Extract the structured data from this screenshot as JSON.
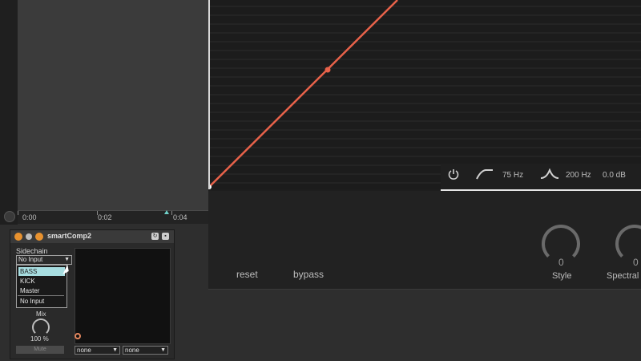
{
  "timeline": {
    "labels": [
      "0:00",
      "0:02",
      "0:04"
    ]
  },
  "plugin": {
    "eq": {
      "low_freq": "75 Hz",
      "mid_freq": "200 Hz",
      "gain": "0.0 dB"
    },
    "buttons": {
      "reset": "reset",
      "bypass": "bypass"
    },
    "knobs": [
      {
        "value": "0",
        "label": "Style"
      },
      {
        "value": "0",
        "label": "Spectral"
      }
    ],
    "curve_color": "#e8624a"
  },
  "device": {
    "title": "smartComp2",
    "sidechain_label": "Sidechain",
    "sidechain_value": "No Input",
    "dropdown_options": [
      "BASS",
      "KICK",
      "Master",
      "No Input"
    ],
    "selected_option": "BASS",
    "mix_label": "Mix",
    "mix_value": "100 %",
    "mute_label": "Mute",
    "select_a": "none",
    "select_b": "none",
    "accent_color": "#e4875f"
  },
  "icons": {
    "power": "power-icon",
    "highpass": "highpass-filter-icon",
    "bell": "bell-filter-icon",
    "pause": "pause-icon",
    "loop": "loop-icon"
  }
}
